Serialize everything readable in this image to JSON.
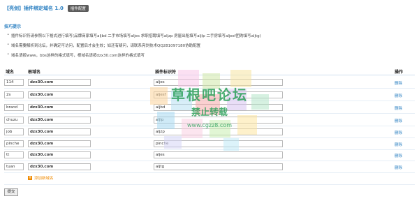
{
  "header": {
    "title": "【亮剑】插件绑定域名 1.0",
    "badge": "插件配置"
  },
  "tips": {
    "heading": "技巧提示",
    "items": [
      "插件标识符请参照以下格式进行填写(品牌商家填写aljbd 二手市场填写aljes 求职招聘填写aljzp 房屋出租填写aljlp 二手房填写aljesf团购填写aljtg)",
      "域名需要解析到论坛，并确定可访问，配置后才会生效；如还有疑问，请联系亮剑技术QQ281097180协助配置",
      "域名请按www，bbs这样的格式填写，根域名请按dzx30.com这样的格式填写"
    ]
  },
  "table": {
    "headers": {
      "domain_prefix": "域名",
      "root_domain": "根域名",
      "plugin_id": "插件标识符",
      "action": "操作"
    },
    "delete_label": "删除",
    "rows": [
      {
        "prefix": "114",
        "root": "dzx30.com",
        "plugin": "aljes"
      },
      {
        "prefix": "2s",
        "root": "dzx30.com",
        "plugin": "aljesf"
      },
      {
        "prefix": "brand",
        "root": "dzx30.com",
        "plugin": "aljbd"
      },
      {
        "prefix": "chuzu",
        "root": "dzx30.com",
        "plugin": "aljlp"
      },
      {
        "prefix": "job",
        "root": "dzx30.com",
        "plugin": "aljzp"
      },
      {
        "prefix": "pinche",
        "root": "dzx30.com",
        "plugin": "pinche"
      },
      {
        "prefix": "tt",
        "root": "dzx30.com",
        "plugin": "aljes"
      },
      {
        "prefix": "tuan",
        "root": "dzx30.com",
        "plugin": "aljtg"
      }
    ]
  },
  "add_link": "添加新域名",
  "submit_label": "提交",
  "watermark": {
    "line1": "草根吧论坛",
    "line2": "禁止转载",
    "line3": "www.cgzz8.com"
  }
}
